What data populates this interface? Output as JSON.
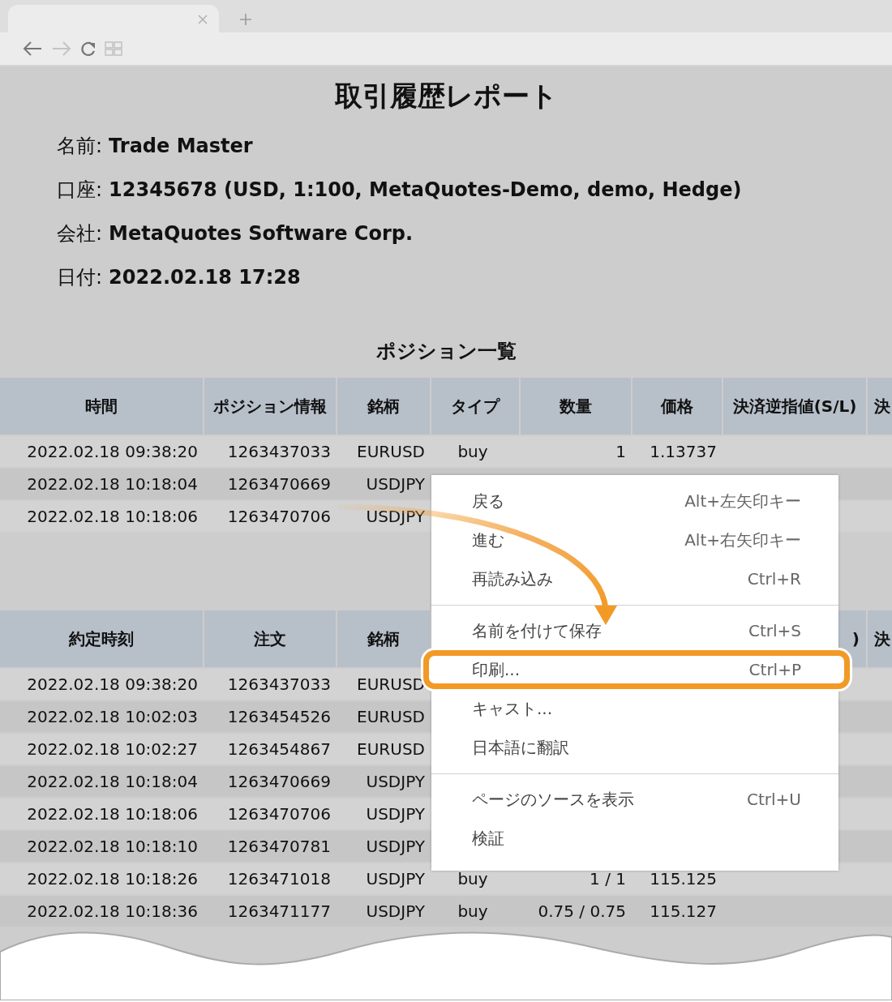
{
  "report": {
    "title": "取引履歴レポート",
    "info": [
      {
        "label": "名前:",
        "value": "Trade Master"
      },
      {
        "label": "口座:",
        "value": "12345678 (USD, 1:100, MetaQuotes-Demo, demo, Hedge)"
      },
      {
        "label": "会社:",
        "value": "MetaQuotes Software Corp."
      },
      {
        "label": "日付:",
        "value": "2022.02.18 17:28"
      }
    ]
  },
  "positions": {
    "title": "ポジション一覧",
    "columns": [
      "時間",
      "ポジション情報",
      "銘柄",
      "タイプ",
      "数量",
      "価格",
      "決済逆指値(S/L)",
      "決"
    ],
    "rows": [
      [
        "2022.02.18 09:38:20",
        "1263437033",
        "EURUSD",
        "buy",
        "1",
        "1.13737"
      ],
      [
        "2022.02.18 10:18:04",
        "1263470669",
        "USDJPY"
      ],
      [
        "2022.02.18 10:18:06",
        "1263470706",
        "USDJPY"
      ]
    ]
  },
  "deals": {
    "columns": [
      "約定時刻",
      "注文",
      "銘柄",
      "",
      "",
      "",
      ")",
      "決"
    ],
    "rows": [
      [
        "2022.02.18 09:38:20",
        "1263437033",
        "EURUSD"
      ],
      [
        "2022.02.18 10:02:03",
        "1263454526",
        "EURUSD"
      ],
      [
        "2022.02.18 10:02:27",
        "1263454867",
        "EURUSD"
      ],
      [
        "2022.02.18 10:18:04",
        "1263470669",
        "USDJPY"
      ],
      [
        "2022.02.18 10:18:06",
        "1263470706",
        "USDJPY"
      ],
      [
        "2022.02.18 10:18:10",
        "1263470781",
        "USDJPY"
      ],
      [
        "2022.02.18 10:18:26",
        "1263471018",
        "USDJPY",
        "buy",
        "1 / 1",
        "115.125"
      ],
      [
        "2022.02.18 10:18:36",
        "1263471177",
        "USDJPY",
        "buy",
        "0.75 / 0.75",
        "115.127"
      ]
    ]
  },
  "context_menu": {
    "groups": [
      [
        {
          "label": "戻る",
          "shortcut": "Alt+左矢印キー",
          "highlighted": false
        },
        {
          "label": "進む",
          "shortcut": "Alt+右矢印キー",
          "highlighted": false
        },
        {
          "label": "再読み込み",
          "shortcut": "Ctrl+R",
          "highlighted": false
        }
      ],
      [
        {
          "label": "名前を付けて保存",
          "shortcut": "Ctrl+S",
          "highlighted": false
        },
        {
          "label": "印刷...",
          "shortcut": "Ctrl+P",
          "highlighted": true
        },
        {
          "label": "キャスト...",
          "highlighted": false
        },
        {
          "label": "日本語に翻訳",
          "highlighted": false
        }
      ],
      [
        {
          "label": "ページのソースを表示",
          "shortcut": "Ctrl+U",
          "highlighted": false
        },
        {
          "label": "検証",
          "highlighted": false
        }
      ]
    ]
  }
}
